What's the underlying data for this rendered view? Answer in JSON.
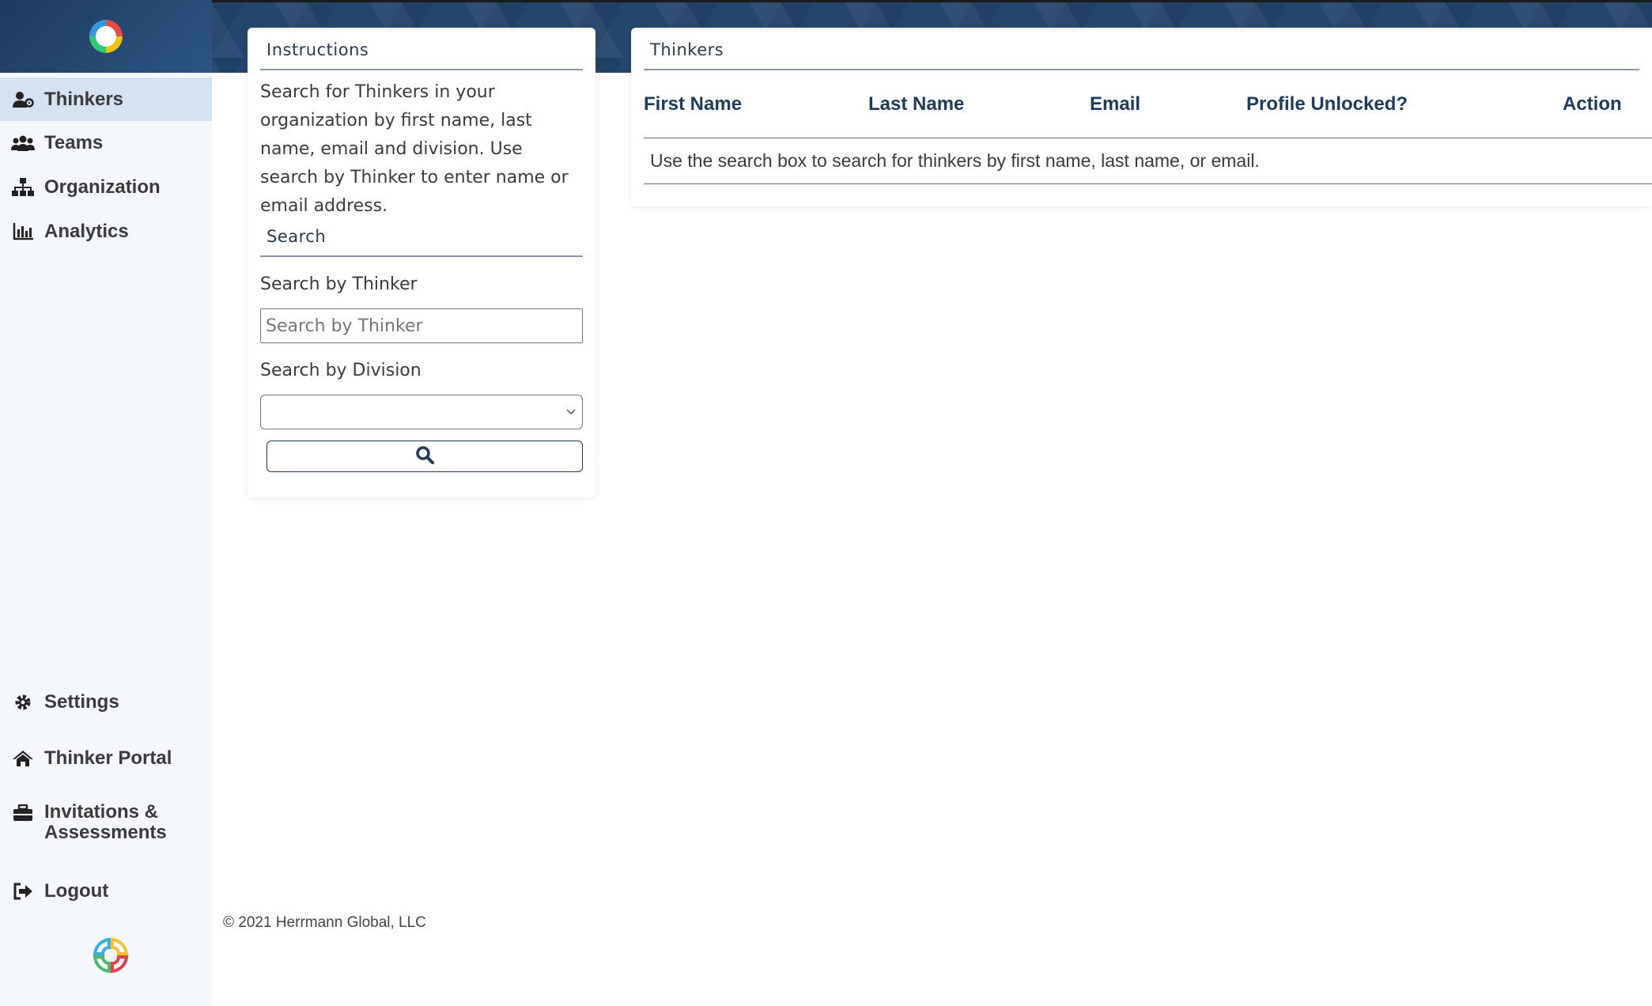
{
  "sidebar": {
    "items": [
      {
        "label": "Thinkers",
        "icon": "user-gear-icon",
        "active": true
      },
      {
        "label": "Teams",
        "icon": "users-icon",
        "active": false
      },
      {
        "label": "Organization",
        "icon": "sitemap-icon",
        "active": false
      },
      {
        "label": "Analytics",
        "icon": "bar-chart-icon",
        "active": false
      }
    ],
    "bottom_items": [
      {
        "label": "Settings",
        "icon": "gear-icon"
      },
      {
        "label": "Thinker Portal",
        "icon": "home-icon"
      },
      {
        "label": "Invitations & Assessments",
        "icon": "toolbox-icon"
      },
      {
        "label": "Logout",
        "icon": "logout-icon"
      }
    ]
  },
  "instructions": {
    "title": "Instructions",
    "text": "Search for Thinkers in your organization by first name, last name, email and division. Use search by Thinker to enter name or email address.",
    "search_title": "Search",
    "thinker_label": "Search by Thinker",
    "thinker_placeholder": "Search by Thinker",
    "division_label": "Search by Division",
    "division_value": ""
  },
  "thinkers": {
    "title": "Thinkers",
    "columns": [
      "First Name",
      "Last Name",
      "Email",
      "Profile Unlocked?",
      "Action"
    ],
    "message": "Use the search box to search for thinkers by first name, last name, or email."
  },
  "footer": {
    "copyright": "© 2021 Herrmann Global, LLC"
  },
  "colors": {
    "banner": "#23466f",
    "sidebar_bg": "#f4f8fc",
    "active_item": "#d4e2f1",
    "header_text": "#1f3b5a"
  }
}
